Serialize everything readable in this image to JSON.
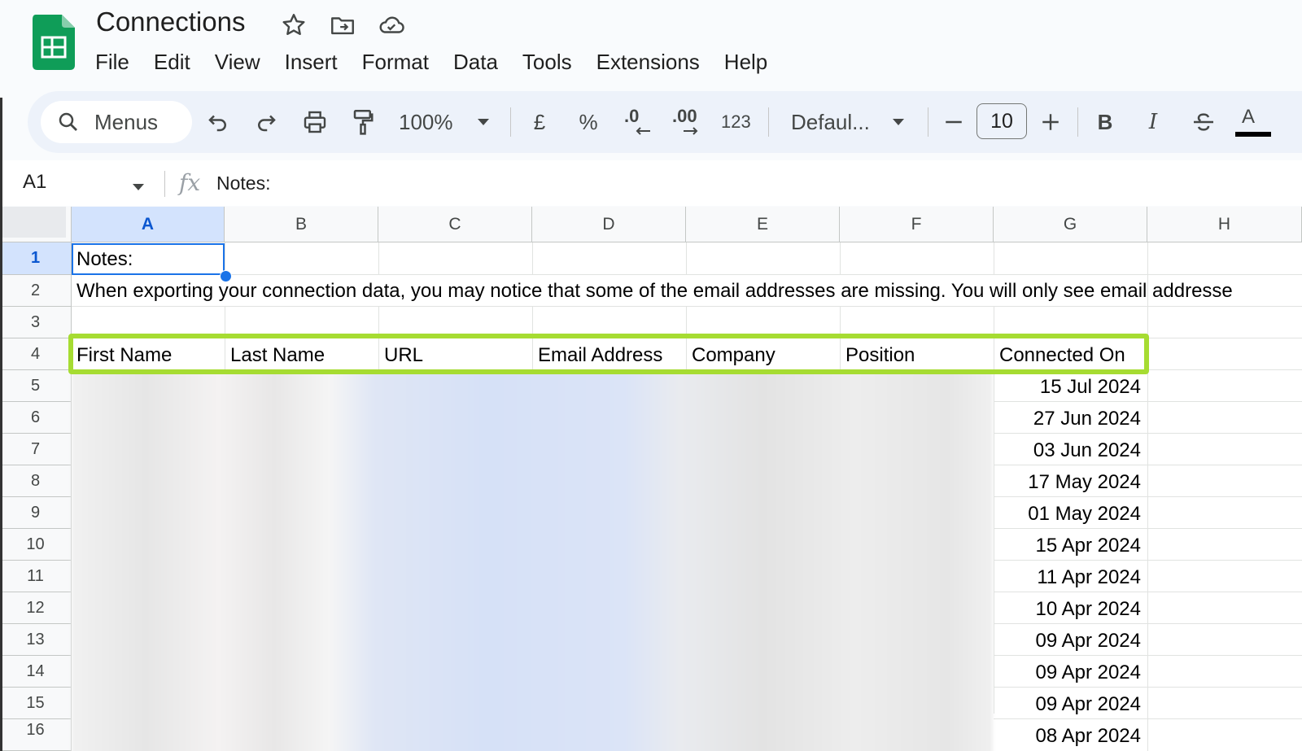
{
  "app": {
    "doc_title": "Connections",
    "title_icons": [
      "star-icon",
      "move-to-folder-icon",
      "cloud-saved-icon"
    ],
    "brand_color": "#0f9d58"
  },
  "menu": [
    "File",
    "Edit",
    "View",
    "Insert",
    "Format",
    "Data",
    "Tools",
    "Extensions",
    "Help"
  ],
  "toolbar": {
    "search_label": "Menus",
    "zoom": "100%",
    "currency": "£",
    "percent": "%",
    "decrease_decimal": ".0",
    "increase_decimal": ".00",
    "number_format": "123",
    "font": "Defaul...",
    "font_size": "10",
    "bold": "B",
    "italic": "I",
    "text_color": "A",
    "icons": [
      "search-icon",
      "undo-icon",
      "redo-icon",
      "print-icon",
      "paint-format-icon",
      "zoom-dropdown-icon",
      "font-dropdown-icon",
      "minus-icon",
      "plus-icon",
      "strikethrough-icon",
      "text-color-icon"
    ]
  },
  "formula_bar": {
    "name_box": "A1",
    "fx": "fx",
    "content": "Notes:"
  },
  "grid": {
    "columns": [
      "A",
      "B",
      "C",
      "D",
      "E",
      "F",
      "G",
      "H"
    ],
    "rows": [
      "1",
      "2",
      "3",
      "4",
      "5",
      "6",
      "7",
      "8",
      "9",
      "10",
      "11",
      "12",
      "13",
      "14",
      "15",
      "16"
    ],
    "a1": "Notes:",
    "a2": "When exporting your connection data, you may notice that some of the email addresses are missing. You will only see email addresse",
    "headers": [
      "First Name",
      "Last Name",
      "URL",
      "Email Address",
      "Company",
      "Position",
      "Connected On"
    ],
    "connected_on": [
      "15 Jul 2024",
      "27 Jun 2024",
      "03 Jun 2024",
      "17 May 2024",
      "01 May 2024",
      "15 Apr 2024",
      "11 Apr 2024",
      "10 Apr 2024",
      "09 Apr 2024",
      "09 Apr 2024",
      "09 Apr 2024",
      "08 Apr 2024"
    ],
    "highlight_color": "#a6dc32",
    "selection_color": "#1a73e8"
  }
}
